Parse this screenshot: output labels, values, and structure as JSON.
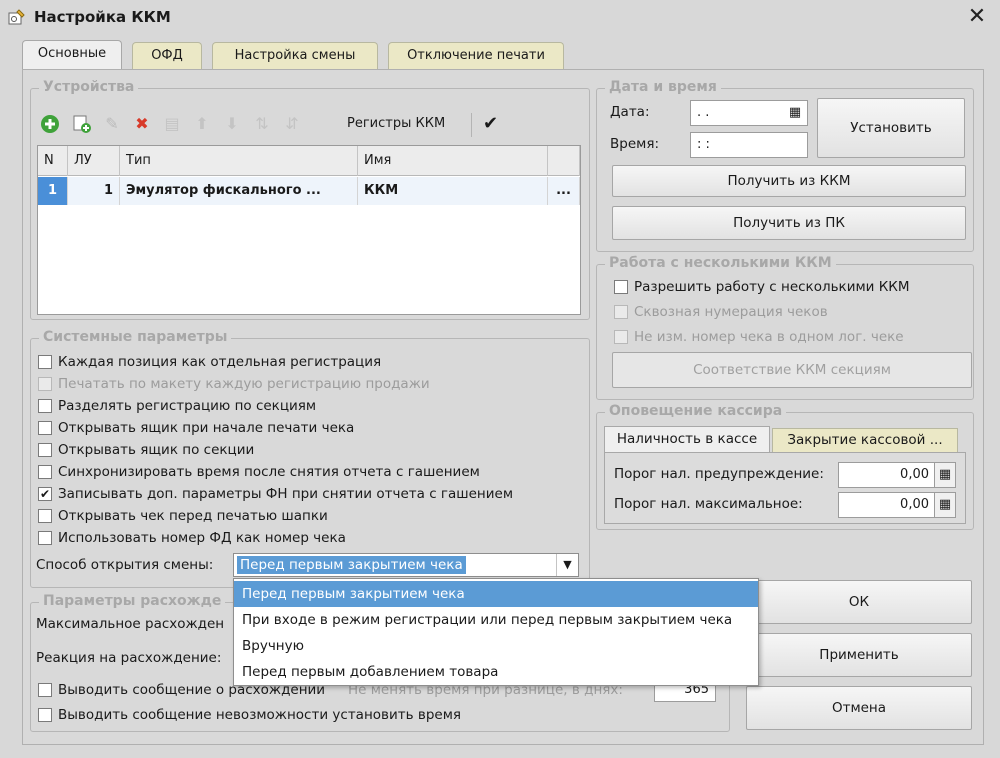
{
  "window": {
    "title": "Настройка ККМ",
    "close_glyph": "✕"
  },
  "tabs": [
    {
      "label": "Основные"
    },
    {
      "label": "ОФД"
    },
    {
      "label": "Настройка смены"
    },
    {
      "label": "Отключение печати"
    }
  ],
  "devices": {
    "legend": "Устройства",
    "toolbar": {
      "registers_label": "Регистры ККМ",
      "check_glyph": "✔"
    },
    "columns": [
      "N",
      "ЛУ",
      "Тип",
      "Имя"
    ],
    "rows": [
      {
        "n": "1",
        "lu": "1",
        "type": "Эмулятор фискального ...",
        "name": "ККМ",
        "more": "..."
      }
    ]
  },
  "system_params": {
    "legend": "Системные параметры",
    "options": [
      {
        "label": "Каждая позиция как отдельная регистрация",
        "checked": false,
        "disabled": false
      },
      {
        "label": "Печатать по макету каждую регистрацию продажи",
        "checked": false,
        "disabled": true
      },
      {
        "label": "Разделять регистрацию по секциям",
        "checked": false,
        "disabled": false
      },
      {
        "label": "Открывать ящик при начале печати чека",
        "checked": false,
        "disabled": false
      },
      {
        "label": "Открывать ящик по секции",
        "checked": false,
        "disabled": false
      },
      {
        "label": "Синхронизировать время после снятия отчета с гашением",
        "checked": false,
        "disabled": false
      },
      {
        "label": "Записывать доп. параметры ФН при снятии отчета с гашением",
        "checked": true,
        "disabled": false
      },
      {
        "label": "Открывать чек перед печатью шапки",
        "checked": false,
        "disabled": false
      },
      {
        "label": "Использовать номер ФД как номер чека",
        "checked": false,
        "disabled": false
      }
    ],
    "shift_open_label": "Способ открытия смены:",
    "shift_open_value": "Перед первым закрытием чека",
    "shift_open_options": [
      "Перед первым закрытием чека",
      "При входе в режим регистрации или перед первым закрытием чека",
      "Вручную",
      "Перед первым добавлением товара"
    ]
  },
  "discrepancy": {
    "legend": "Параметры расхожде",
    "max_label": "Максимальное расхожден",
    "reaction_label": "Реакция на расхождение:",
    "show_msg_label": "Выводить сообщение о расхождении",
    "no_change_label": "Не менять время при разнице, в днях:",
    "days_value": "365",
    "show_impossible_label": "Выводить сообщение невозможности установить время"
  },
  "datetime": {
    "legend": "Дата и время",
    "date_label": "Дата:",
    "date_value": " .  .",
    "time_label": "Время:",
    "time_value": " :  :",
    "set_button": "Установить",
    "from_kkm_button": "Получить из ККМ",
    "from_pc_button": "Получить из ПК"
  },
  "multi_kkm": {
    "legend": "Работа с несколькими ККМ",
    "allow_label": "Разрешить работу с несколькими ККМ",
    "through_label": "Сквозная нумерация чеков",
    "no_change_label": "Не изм. номер чека в одном лог. чеке",
    "sections_button": "Соответствие ККМ секциям"
  },
  "cashier_alert": {
    "legend": "Оповещение кассира",
    "tabs": [
      "Наличность в кассе",
      "Закрытие кассовой ..."
    ],
    "warn_label": "Порог нал. предупреждение:",
    "warn_value": "0,00",
    "max_label": "Порог нал. максимальное:",
    "max_value": "0,00"
  },
  "buttons": {
    "ok": "ОК",
    "apply": "Применить",
    "cancel": "Отмена"
  },
  "colors": {
    "tab_inactive": "#ebe8c6",
    "selection": "#5b9bd5",
    "delete_red": "#d83a2a",
    "add_green": "#3fa23a"
  }
}
